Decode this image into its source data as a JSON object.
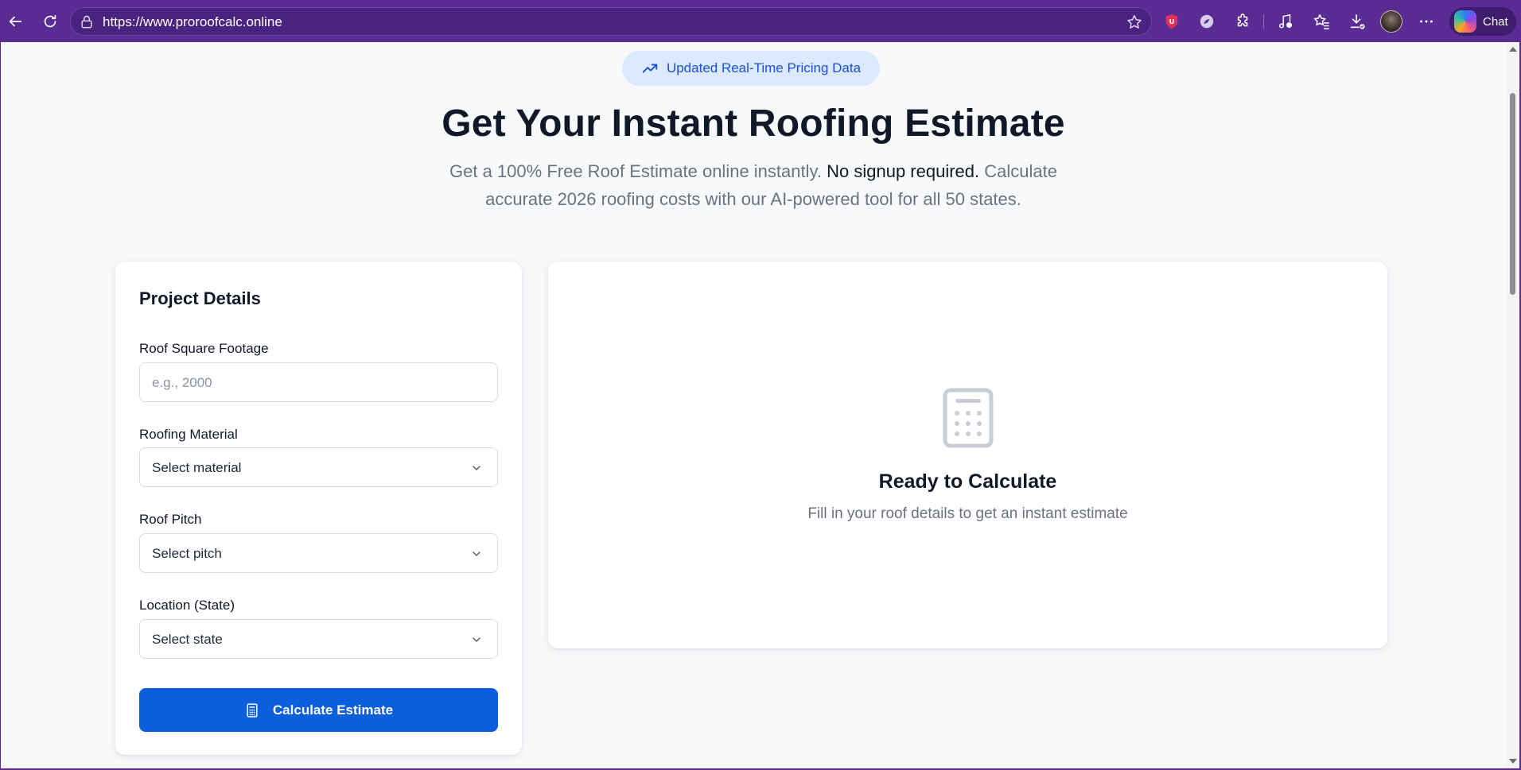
{
  "browser": {
    "url": "https://www.proroofcalc.online",
    "chat_label": "Chat"
  },
  "badge": {
    "label": "Updated Real-Time Pricing Data"
  },
  "hero": {
    "title": "Get Your Instant Roofing Estimate",
    "subtitle_pre": "Get a 100% Free Roof Estimate online instantly.",
    "subtitle_bold": "No signup required.",
    "subtitle_post": "Calculate accurate 2026 roofing costs with our AI-powered tool for all 50 states."
  },
  "form": {
    "title": "Project Details",
    "square_footage": {
      "label": "Roof Square Footage",
      "value": "",
      "placeholder": "e.g., 2000"
    },
    "material": {
      "label": "Roofing Material",
      "selected": "Select material"
    },
    "pitch": {
      "label": "Roof Pitch",
      "selected": "Select pitch"
    },
    "state": {
      "label": "Location (State)",
      "selected": "Select state"
    },
    "submit_label": "Calculate Estimate"
  },
  "result": {
    "title": "Ready to Calculate",
    "subtitle": "Fill in your roof details to get an instant estimate"
  },
  "colors": {
    "chrome": "#5a2b93",
    "accent": "#0b5fdc",
    "badge_bg": "#dbeafe",
    "badge_text": "#1d4ed8"
  },
  "icons": {
    "badge": "trending-up-icon",
    "result": "calculator-icon",
    "submit": "calculator-icon",
    "select": "chevron-down-icon"
  }
}
